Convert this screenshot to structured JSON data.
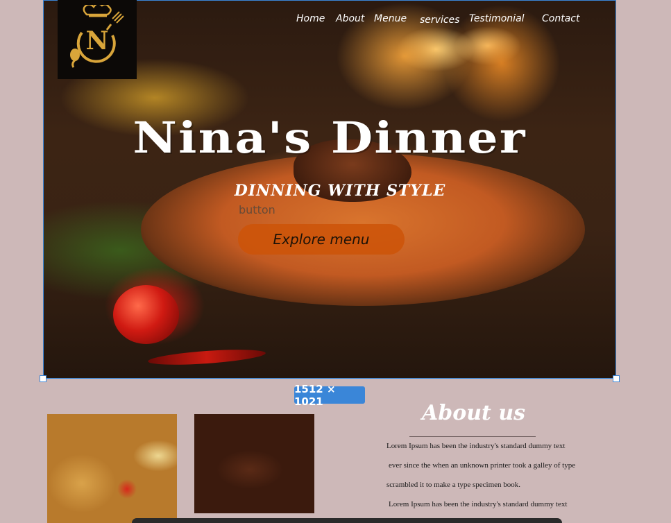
{
  "nav": {
    "items": [
      {
        "label": "Home"
      },
      {
        "label": "About"
      },
      {
        "label": "Menue"
      },
      {
        "label": "services"
      },
      {
        "label": "Testimonial"
      },
      {
        "label": "Contact"
      }
    ]
  },
  "logo": {
    "letter": "N"
  },
  "hero": {
    "title": "Nina's Dinner",
    "subtitle": "DINNING WITH STYLE",
    "button_caption": "button",
    "cta_label": "Explore menu"
  },
  "selection": {
    "dimensions": "1512 × 1021",
    "accent_color": "#3a86d8"
  },
  "about": {
    "title": "About us",
    "lines": [
      "Lorem Ipsum has been the industry's standard dummy text",
      "ever since the when an unknown printer took a galley of type",
      "scrambled it to make a type specimen book.",
      "Lorem Ipsum has been the industry's standard dummy text"
    ]
  },
  "colors": {
    "page_background": "#cdb8b8",
    "cta_background": "#cc5408",
    "logo_gold": "#d9a53a"
  }
}
